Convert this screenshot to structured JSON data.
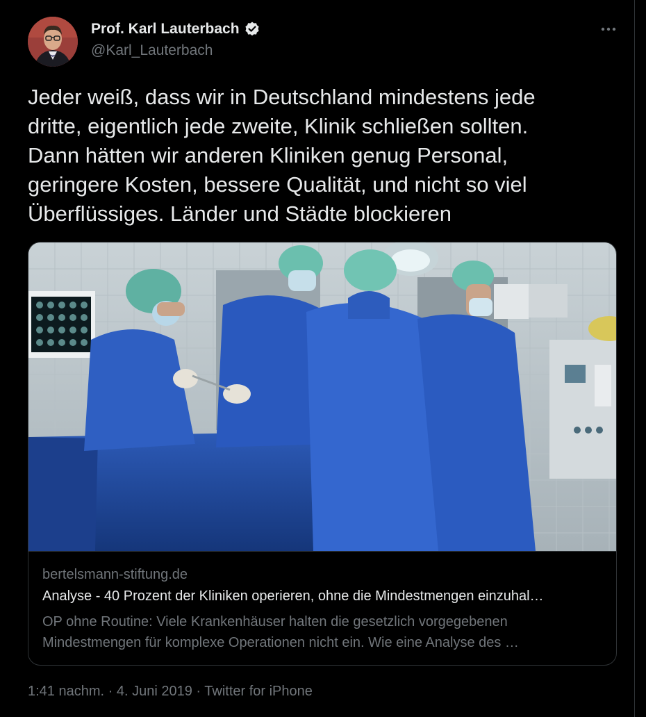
{
  "author": {
    "name": "Prof. Karl Lauterbach",
    "handle": "@Karl_Lauterbach",
    "verified": true,
    "verified_color": "#e7e9ea"
  },
  "more_icon": "more-horizontal-icon",
  "tweet": {
    "text": "Jeder weiß, dass wir in Deutschland mindestens jede\ndritte, eigentlich jede zweite, Klinik schließen sollten.\nDann hätten wir anderen Kliniken genug Personal,\ngeringere Kosten, bessere Qualität, und nicht so viel\nÜberflüssiges. Länder und Städte blockieren"
  },
  "card": {
    "domain": "bertelsmann-stiftung.de",
    "title": "Analyse - 40 Prozent der Kliniken operieren, ohne die Mindestmengen einzuhal…",
    "description": "OP ohne Routine: Viele Krankenhäuser halten die gesetzlich vorgegebenen\nMindestmengen für komplexe Operationen nicht ein. Wie eine Analyse des …"
  },
  "meta": {
    "time": "1:41 nachm.",
    "sep1": " · ",
    "date": "4. Juni 2019",
    "sep2": " · ",
    "source": "Twitter for iPhone"
  },
  "colors": {
    "background": "#000000",
    "text_primary": "#e7e9ea",
    "text_secondary": "#71767b",
    "border": "#2f3336",
    "scrub_blue": "#2a52a8"
  }
}
